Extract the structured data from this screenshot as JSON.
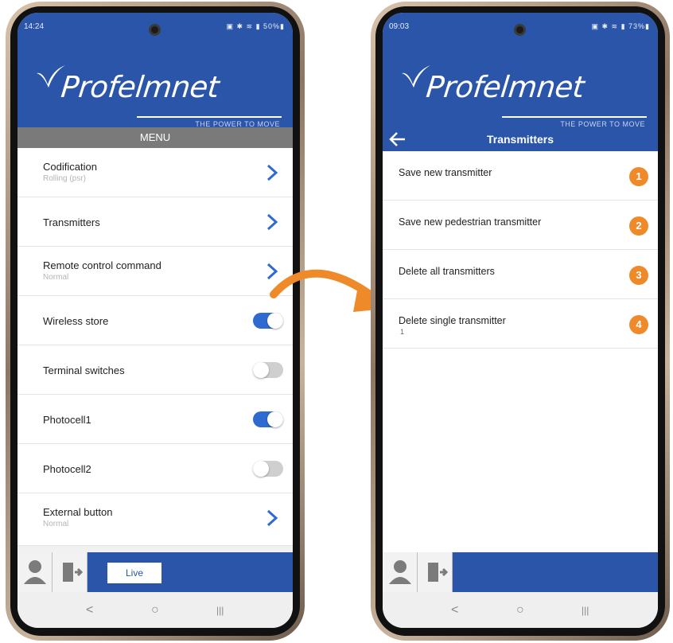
{
  "left_phone": {
    "status": {
      "time": "14:24",
      "icons": "▣ ✱ ≋ ▮ 50%▮"
    },
    "brand": {
      "name": "Profelmnet",
      "tagline": "THE POWER TO MOVE"
    },
    "menu_header": "MENU",
    "items": [
      {
        "label": "Codification",
        "sub": "Rolling (psr)"
      },
      {
        "label": "Transmitters",
        "sub": ""
      },
      {
        "label": "Remote control command",
        "sub": "Normal"
      },
      {
        "label": "Wireless store",
        "toggle": "on"
      },
      {
        "label": "Terminal switches",
        "toggle": "off"
      },
      {
        "label": "Photocell1",
        "toggle": "on"
      },
      {
        "label": "Photocell2",
        "toggle": "off"
      },
      {
        "label": "External button",
        "sub": "Normal"
      }
    ],
    "bottom": {
      "live_label": "Live"
    },
    "nav": {
      "back": "<",
      "home": "○",
      "recents": "|||"
    }
  },
  "right_phone": {
    "status": {
      "time": "09:03",
      "icons": "▣ ✱ ≋ ▮ 73%▮"
    },
    "brand": {
      "name": "Profelmnet",
      "tagline": "THE POWER TO MOVE"
    },
    "title": "Transmitters",
    "items": [
      {
        "label": "Save new transmitter",
        "badge": "1",
        "sub": ""
      },
      {
        "label": "Save new pedestrian transmitter",
        "badge": "2",
        "sub": ""
      },
      {
        "label": "Delete all transmitters",
        "badge": "3",
        "sub": ""
      },
      {
        "label": "Delete single transmitter",
        "badge": "4",
        "sub": "1"
      }
    ],
    "nav": {
      "back": "<",
      "home": "○",
      "recents": "|||"
    }
  },
  "colors": {
    "brand_blue": "#2a55a8",
    "badge_orange": "#ef8a2b",
    "toggle_on": "#2f6ad1",
    "arrow_orange": "#ef8a2b"
  }
}
